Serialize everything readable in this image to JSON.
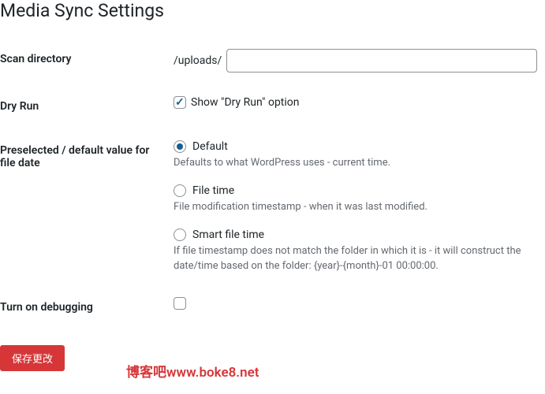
{
  "title": "Media Sync Settings",
  "fields": {
    "scanDirectory": {
      "label": "Scan directory",
      "prefix": "/uploads/",
      "value": ""
    },
    "dryRun": {
      "label": "Dry Run",
      "checkboxLabel": "Show \"Dry Run\" option",
      "checked": true
    },
    "fileDate": {
      "label": "Preselected / default value for file date",
      "options": {
        "default": {
          "label": "Default",
          "description": "Defaults to what WordPress uses - current time."
        },
        "fileTime": {
          "label": "File time",
          "description": "File modification timestamp - when it was last modified."
        },
        "smartFileTime": {
          "label": "Smart file time",
          "description": "If file timestamp does not match the folder in which it is - it will construct the date/time based on the folder: {year}-{month}-01 00:00:00."
        }
      }
    },
    "debugging": {
      "label": "Turn on debugging",
      "checked": false
    }
  },
  "submitLabel": "保存更改",
  "watermark": "博客吧www.boke8.net"
}
